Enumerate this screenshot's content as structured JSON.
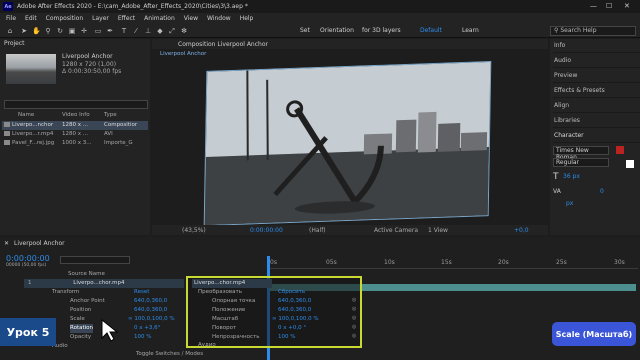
{
  "app": {
    "logo": "Ae",
    "title": "Adobe After Effects 2020 - E:\\cam_Adobe_After_Effects_2020\\Cities\\3\\3.aep *"
  },
  "menu": [
    "File",
    "Edit",
    "Composition",
    "Layer",
    "Effect",
    "Animation",
    "View",
    "Window",
    "Help"
  ],
  "toolbar": {
    "snapping": "Set",
    "orientation": "Orientation",
    "for3d": "for 3D layers",
    "workspace_default": "Default",
    "workspace_learn": "Learn",
    "search_placeholder": "Search Help"
  },
  "project": {
    "tab": "Project",
    "comp_name": "Liverpool Anchor",
    "comp_size": "1280 x 720 (1,00)",
    "comp_duration": "Δ 0:00:30:50,00 fps",
    "columns": {
      "name": "Name",
      "video_info": "Video Info",
      "type": "Type"
    },
    "items": [
      {
        "name": "Liverpo...nchor",
        "info": "1280 x ...",
        "type": "Compositior"
      },
      {
        "name": "Liverpo...r.mp4",
        "info": "1280 x ...",
        "type": "AVI"
      },
      {
        "name": "Pavel_F...rej.jpg",
        "info": "1000 x 3...",
        "type": "Importe_G"
      }
    ]
  },
  "composition": {
    "tab": "Composition Liverpool Anchor",
    "subtab": "Liverpool Anchor",
    "zoom": "(43,5%)",
    "time": "0:00:00:00",
    "resolution": "(Half)",
    "camera": "Active Camera",
    "views": "1 View",
    "offset": "+0,0"
  },
  "right_panels": [
    "Info",
    "Audio",
    "Preview",
    "Effects & Presets",
    "Align",
    "Libraries",
    "Character"
  ],
  "character": {
    "font": "Times New Roman",
    "style": "Regular",
    "size": "36 px",
    "unit_px": "px",
    "zero": "0"
  },
  "timeline": {
    "comp_tab": "Liverpool Anchor",
    "timecode": "0:00:00:00",
    "fps": "00000 (50,00 fps)",
    "ticks": [
      "0s",
      "05s",
      "10s",
      "15s",
      "20s",
      "25s",
      "30s"
    ],
    "source_name_col": "Source Name",
    "layer_name": "Liverpo...chor.mp4",
    "layer_index": "1",
    "transform": "Transform",
    "reset": "Reset",
    "props": [
      {
        "name": "Anchor Point",
        "value": "640,0,360,0"
      },
      {
        "name": "Position",
        "value": "640,0,360,0"
      },
      {
        "name": "Scale",
        "value": "∞ 100,0,100,0 %"
      },
      {
        "name": "Rotation",
        "value": "0 x +3,6°"
      },
      {
        "name": "Opacity",
        "value": "100 %"
      }
    ],
    "audio": "Audio",
    "footer": "Toggle Switches / Modes"
  },
  "highlight": {
    "layer": "Liverpo...chor.mp4",
    "group": "Преобразовать",
    "reset": "Сбросить",
    "props": [
      {
        "name": "Опорная точка",
        "value": "640,0,360,0"
      },
      {
        "name": "Положение",
        "value": "640,0,360,0"
      },
      {
        "name": "Масштаб",
        "value": "∞ 100,0,100,0 %"
      },
      {
        "name": "Поворот",
        "value": "0 x +0,0 °"
      },
      {
        "name": "Непрозрачность",
        "value": "100 %"
      }
    ],
    "audio": "Аудио"
  },
  "badges": {
    "lesson": "Урок 5",
    "topic": "Scale (Масштаб)"
  },
  "colors": {
    "accent": "#2d8ceb",
    "highlight": "#c8d932",
    "badge_blue": "#3b55d8"
  }
}
